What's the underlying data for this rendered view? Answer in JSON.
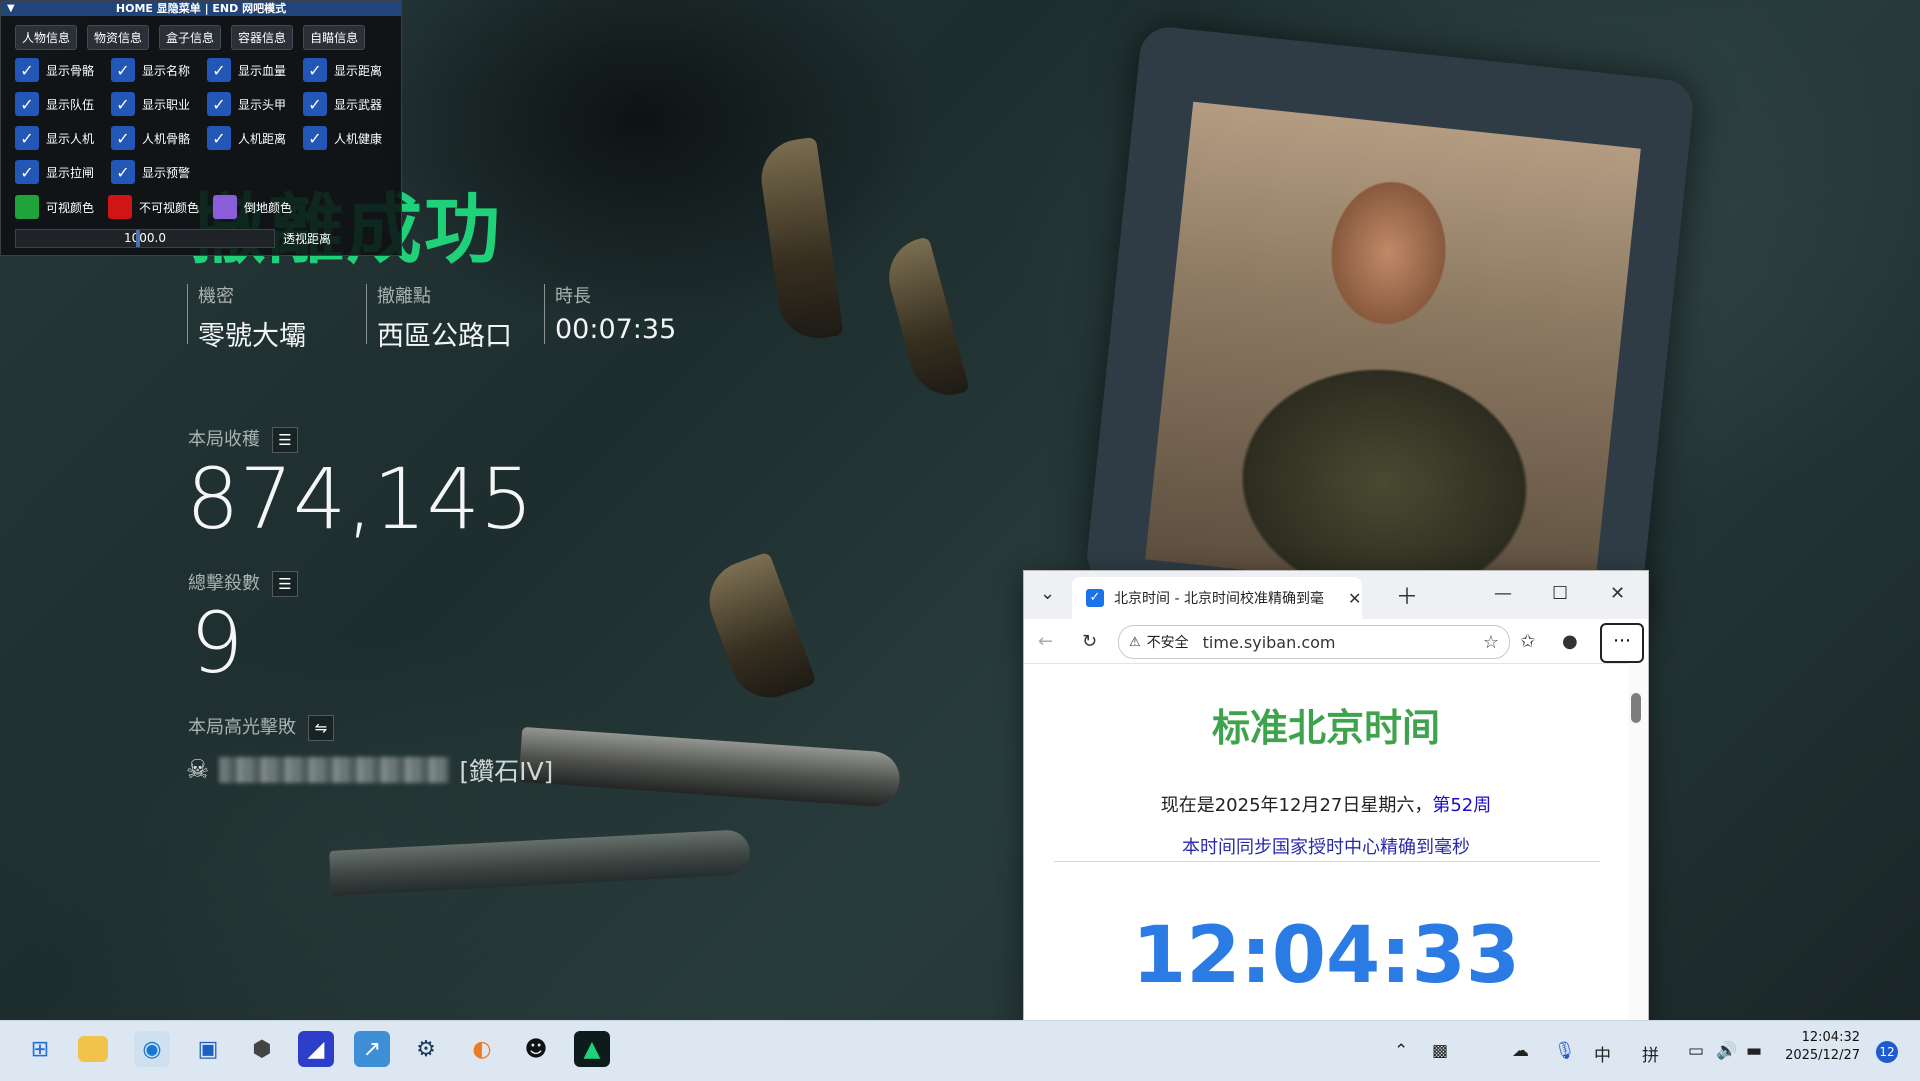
{
  "menu": {
    "title": "HOME 显隐菜单 | END 网吧模式",
    "tabs": [
      "人物信息",
      "物资信息",
      "盒子信息",
      "容器信息",
      "自瞄信息"
    ],
    "checkboxes": [
      [
        "显示骨骼",
        "显示名称",
        "显示血量",
        "显示距离"
      ],
      [
        "显示队伍",
        "显示职业",
        "显示头甲",
        "显示武器"
      ],
      [
        "显示人机",
        "人机骨骼",
        "人机距离",
        "人机健康"
      ],
      [
        "显示拉闸",
        "显示预警"
      ]
    ],
    "colors": [
      {
        "label": "可视颜色",
        "color": "#1fa33a"
      },
      {
        "label": "不可视颜色",
        "color": "#d01515"
      },
      {
        "label": "倒地颜色",
        "color": "#8a5ed8"
      }
    ],
    "slider_value": "1000.0",
    "slider_fraction": 0.47,
    "slider_label": "透视距离"
  },
  "game": {
    "headline": "撤離成功",
    "info": [
      {
        "label": "機密",
        "value": "零號大壩"
      },
      {
        "label": "撤離點",
        "value": "西區公路口"
      },
      {
        "label": "時長",
        "value": "00:07:35"
      }
    ],
    "income_label": "本局收穫",
    "income_value": "874,145",
    "kills_label": "總擊殺數",
    "kills_value": "9",
    "highlight_label": "本局高光擊敗",
    "player_rank": "[鑽石IV]"
  },
  "browser": {
    "tab_title": "北京时间 - 北京时间校准精确到毫",
    "insecure_label": "不安全",
    "url": "time.syiban.com",
    "heading": "标准北京时间",
    "date_text": "现在是2025年12月27日星期六，",
    "week_text": "第52周",
    "sync_text": "本时间同步国家授时中心精确到毫秒",
    "clock": "12:04:33"
  },
  "taskbar": {
    "ime_lang": "中",
    "ime_mode": "拼",
    "time": "12:04:32",
    "date": "2025/12/27",
    "notification_count": "12"
  }
}
